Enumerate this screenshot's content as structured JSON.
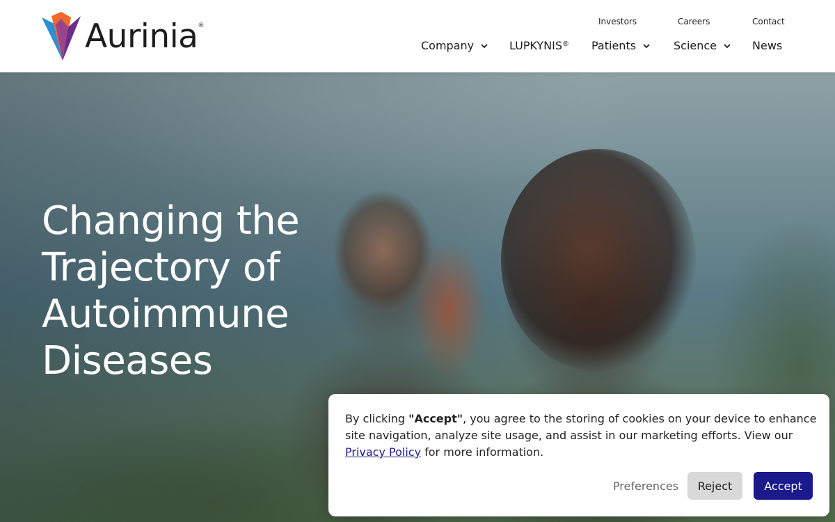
{
  "brand": {
    "name": "Aurinia",
    "registered_mark": "®",
    "colors": {
      "blue": "#2a8fd6",
      "orange": "#ef6a2c",
      "purple": "#6b2d8c",
      "navy": "#1a1a8c"
    }
  },
  "utility_nav": {
    "investors": "Investors",
    "careers": "Careers",
    "contact": "Contact"
  },
  "main_nav": {
    "company": "Company",
    "lupkynis": "LUPKYNIS",
    "lupkynis_mark": "®",
    "patients": "Patients",
    "science": "Science",
    "news": "News",
    "dropdown_icon": "chevron-down-icon"
  },
  "hero": {
    "title_line1": "Changing the",
    "title_line2": "Trajectory of",
    "title_line3": "Autoimmune",
    "title_line4": "Diseases"
  },
  "cookie_banner": {
    "text_before": "By clicking ",
    "text_bold": "\"Accept\"",
    "text_middle": ", you agree to the storing of cookies on your device to enhance site navigation, analyze site usage, and assist in our marketing efforts. View our ",
    "privacy_link": "Privacy Policy",
    "text_after": " for more information.",
    "preferences_label": "Preferences",
    "reject_label": "Reject",
    "accept_label": "Accept"
  }
}
